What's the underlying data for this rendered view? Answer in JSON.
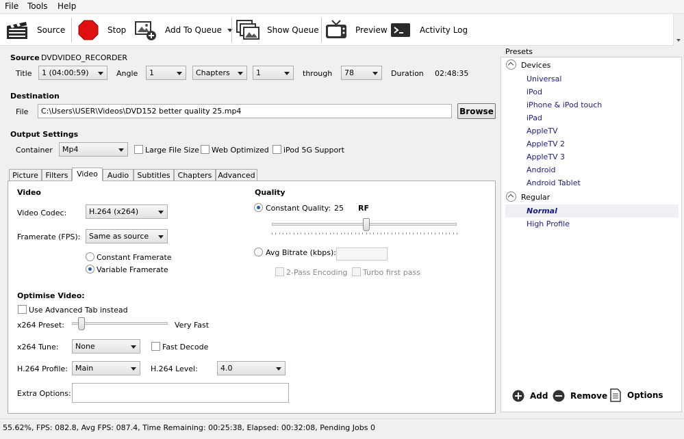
{
  "menu": [
    "File",
    "Tools",
    "Help"
  ],
  "toolbar": {
    "source": "Source",
    "stop": "Stop",
    "add_to_queue": "Add To Queue",
    "show_queue": "Show Queue",
    "preview": "Preview",
    "activity_log": "Activity Log"
  },
  "source": {
    "label": "Source",
    "name": "DVDVIDEO_RECORDER",
    "title_label": "Title",
    "title_value": "1 (04:00:59)",
    "angle_label": "Angle",
    "angle_value": "1",
    "range_mode": "Chapters",
    "range_start": "1",
    "through_label": "through",
    "range_end": "78",
    "duration_label": "Duration",
    "duration_value": "02:48:35"
  },
  "destination": {
    "label": "Destination",
    "file_label": "File",
    "file_path": "C:\\Users\\USER\\Videos\\DVD152 better quality 25.mp4",
    "browse": "Browse"
  },
  "output": {
    "label": "Output Settings",
    "container_label": "Container",
    "container_value": "Mp4",
    "large_file": "Large File Size",
    "web_optimized": "Web Optimized",
    "ipod_support": "iPod 5G Support"
  },
  "tabs": [
    "Picture",
    "Filters",
    "Video",
    "Audio",
    "Subtitles",
    "Chapters",
    "Advanced"
  ],
  "video": {
    "heading": "Video",
    "codec_label": "Video Codec:",
    "codec_value": "H.264 (x264)",
    "fps_label": "Framerate (FPS):",
    "fps_value": "Same as source",
    "constant_framerate": "Constant Framerate",
    "variable_framerate": "Variable Framerate"
  },
  "quality": {
    "heading": "Quality",
    "constant_quality": "Constant Quality:",
    "cq_value": "25",
    "rf": "RF",
    "avg_bitrate": "Avg Bitrate (kbps):",
    "two_pass": "2-Pass Encoding",
    "turbo": "Turbo first pass",
    "slider_fraction": 0.51
  },
  "optimise": {
    "heading": "Optimise Video:",
    "advanced_tab": "Use Advanced Tab instead",
    "preset_label": "x264 Preset:",
    "preset_value": "Very Fast",
    "preset_fraction": 0.1,
    "tune_label": "x264 Tune:",
    "tune_value": "None",
    "fast_decode": "Fast Decode",
    "profile_label": "H.264 Profile:",
    "profile_value": "Main",
    "level_label": "H.264 Level:",
    "level_value": "4.0",
    "extra_label": "Extra Options:"
  },
  "presets": {
    "heading": "Presets",
    "groups": [
      {
        "name": "Devices",
        "items": [
          "Universal",
          "iPod",
          "iPhone & iPod touch",
          "iPad",
          "AppleTV",
          "AppleTV 2",
          "AppleTV 3",
          "Android",
          "Android Tablet"
        ]
      },
      {
        "name": "Regular",
        "items": [
          "Normal",
          "High Profile"
        ]
      }
    ],
    "selected": "Normal",
    "add": "Add",
    "remove": "Remove",
    "options": "Options"
  },
  "status": "55.62%,  FPS: 082.8,  Avg FPS: 087.4,  Time Remaining: 00:25:38,  Elapsed: 00:32:08,  Pending Jobs 0"
}
